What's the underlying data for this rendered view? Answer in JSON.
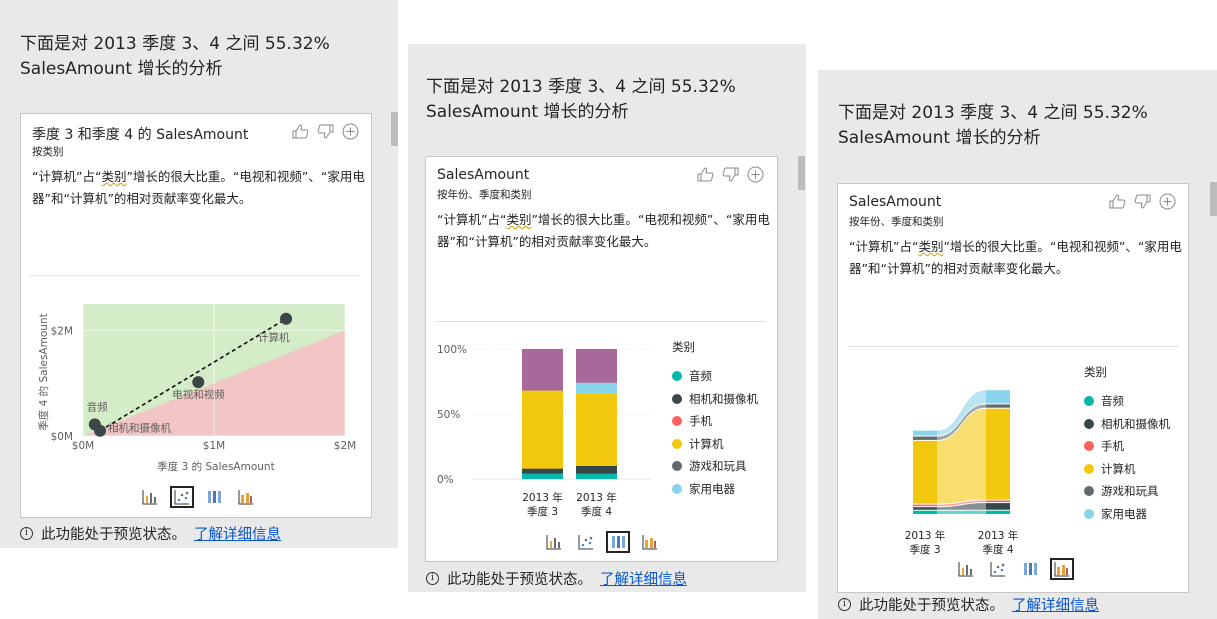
{
  "panel_title": "下面是对 2013 季度 3、4 之间 55.32% SalesAmount 增长的分析",
  "notice": {
    "text": "此功能处于预览状态。",
    "link": "了解详细信息"
  },
  "desc": {
    "part1": "“计算机”占“",
    "keyword": "类别",
    "part2": "”增长的很大比重。“电视和视频”、“家用电器”和“计算机”的相对贡献率变化最大。"
  },
  "cards": [
    {
      "title": "季度 3 和季度 4 的 SalesAmount",
      "subtitle": "按类别"
    },
    {
      "title": "SalesAmount",
      "subtitle": "按年份、季度和类别"
    },
    {
      "title": "SalesAmount",
      "subtitle": "按年份、季度和类别"
    }
  ],
  "icons": [
    "thumbs-up-icon",
    "thumbs-down-icon",
    "add-icon",
    "info-icon",
    "column-chart-icon",
    "scatter-chart-icon",
    "stacked-column-icon",
    "ribbon-chart-icon"
  ],
  "colors": {
    "audio": "#01b8aa",
    "camera": "#374649",
    "phone": "#fd625e",
    "computer": "#f2c80f",
    "games": "#5f6b6d",
    "home": "#8ad4eb",
    "other": "#a66999",
    "link": "#0b56d0"
  },
  "chart_data": [
    {
      "type": "scatter",
      "xlabel": "季度 3 的 SalesAmount",
      "ylabel": "季度 4 的 SalesAmount",
      "xticks": [
        "$0M",
        "$1M",
        "$2M"
      ],
      "yticks": [
        "$0M",
        "$2M"
      ],
      "xlim": [
        0,
        2000000
      ],
      "ylim": [
        0,
        2500000
      ],
      "points": [
        {
          "label": "音频",
          "x": 90000,
          "y": 220000
        },
        {
          "label": "相机和摄像机",
          "x": 130000,
          "y": 100000
        },
        {
          "label": "电视和视频",
          "x": 880000,
          "y": 1020000
        },
        {
          "label": "计算机",
          "x": 1550000,
          "y": 2220000
        }
      ]
    },
    {
      "type": "bar",
      "stacked": "100%",
      "categories": [
        "2013 年 季度 3",
        "2013 年 季度 4"
      ],
      "yticks": [
        "100%",
        "50%",
        "0%"
      ],
      "legend_title": "类别",
      "series": [
        {
          "name": "音频",
          "values": [
            4,
            4
          ]
        },
        {
          "name": "相机和摄像机",
          "values": [
            4,
            6
          ]
        },
        {
          "name": "手机",
          "values": [
            0,
            0
          ]
        },
        {
          "name": "计算机",
          "values": [
            60,
            56
          ]
        },
        {
          "name": "游戏和玩具",
          "values": [
            0,
            0
          ]
        },
        {
          "name": "家用电器",
          "values": [
            0,
            8
          ]
        },
        {
          "name": "",
          "values": [
            32,
            26
          ]
        }
      ]
    },
    {
      "type": "area",
      "subtype": "ribbon",
      "categories": [
        "2013 年 季度 3",
        "2013 年 季度 4"
      ],
      "legend_title": "类别",
      "series": [
        {
          "name": "音频",
          "values": [
            0.02,
            0.02
          ]
        },
        {
          "name": "相机和摄像机",
          "values": [
            0.015,
            0.04
          ]
        },
        {
          "name": "手机",
          "values": [
            0.01,
            0.01
          ]
        },
        {
          "name": "计算机",
          "values": [
            0.38,
            0.55
          ]
        },
        {
          "name": "游戏和玩具",
          "values": [
            0.02,
            0.02
          ]
        },
        {
          "name": "家用电器",
          "values": [
            0.03,
            0.08
          ]
        }
      ]
    }
  ]
}
